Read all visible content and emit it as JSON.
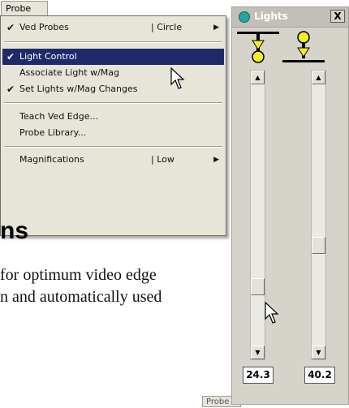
{
  "menu": {
    "title": "Probe",
    "items": [
      {
        "label": "Ved Probes",
        "checked": true,
        "submenu_value": "| Circle",
        "has_submenu": true
      },
      {
        "label": "Light Control",
        "checked": true,
        "selected": true
      },
      {
        "label": "Associate Light w/Mag",
        "checked": false
      },
      {
        "label": "Set Lights w/Mag Changes",
        "checked": true
      },
      {
        "label": "Teach Ved Edge...",
        "checked": false
      },
      {
        "label": "Probe Library...",
        "checked": false
      },
      {
        "label": "Magnifications",
        "checked": false,
        "submenu_value": "| Low",
        "has_submenu": true
      }
    ],
    "checkmark": "✔",
    "arrow": "▶"
  },
  "document": {
    "heading_fragment": "ns",
    "paragraph_lines": [
      "for optimum video edge",
      "n and automatically used"
    ]
  },
  "menu2": {
    "title": "Probe"
  },
  "lights": {
    "title": "Lights",
    "close_label": "X",
    "up_arrow": "▲",
    "down_arrow": "▼",
    "left_value": "24.3",
    "right_value": "40.2",
    "icon_color": "#23a5a1",
    "light_bulb_color": "#f4ee2a"
  }
}
